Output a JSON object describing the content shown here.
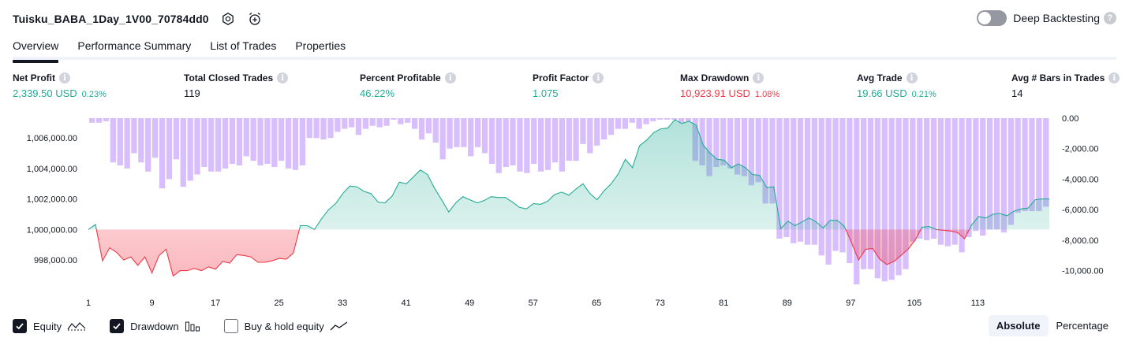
{
  "header": {
    "strategy_name": "Tuisku_BABA_1Day_1V00_70784dd0",
    "icons": [
      "settings-icon",
      "add-alert-icon"
    ]
  },
  "deep_backtesting": {
    "label": "Deep Backtesting",
    "enabled": false,
    "help_icon": "?"
  },
  "tabs": [
    {
      "label": "Overview",
      "active": true
    },
    {
      "label": "Performance Summary",
      "active": false
    },
    {
      "label": "List of Trades",
      "active": false
    },
    {
      "label": "Properties",
      "active": false
    }
  ],
  "metrics": {
    "net_profit": {
      "label": "Net Profit",
      "value": "2,339.50 USD",
      "pct": "0.23%"
    },
    "total_closed_trades": {
      "label": "Total Closed Trades",
      "value": "119"
    },
    "percent_profitable": {
      "label": "Percent Profitable",
      "value": "46.22%"
    },
    "profit_factor": {
      "label": "Profit Factor",
      "value": "1.075"
    },
    "max_drawdown": {
      "label": "Max Drawdown",
      "value": "10,923.91 USD",
      "pct": "1.08%"
    },
    "avg_trade": {
      "label": "Avg Trade",
      "value": "19.66 USD",
      "pct": "0.21%"
    },
    "avg_bars": {
      "label": "Avg # Bars in Trades",
      "value": "14"
    }
  },
  "colors": {
    "profit": "#22ab94",
    "loss": "#f23645",
    "drawdown_bar": "#d1b3fb",
    "equity_area_pos": "#22ab94",
    "equity_area_neg": "#f23645",
    "text": "#131722"
  },
  "chart_data": {
    "type": "line",
    "left_axis": {
      "ticks": [
        998000,
        1000000,
        1002000,
        1004000,
        1006000
      ],
      "tick_labels": [
        "998,000.00",
        "1,000,000.00",
        "1,002,000.00",
        "1,004,000.00",
        "1,006,000.00"
      ],
      "range": [
        996300,
        1007300
      ]
    },
    "right_axis": {
      "ticks": [
        0,
        -2000,
        -4000,
        -6000,
        -8000,
        -10000
      ],
      "tick_labels": [
        "0.00",
        "-2,000.00",
        "-4,000.00",
        "-6,000.00",
        "-8,000.00",
        "-10,000.00"
      ],
      "range": [
        -11000,
        0
      ]
    },
    "x_axis": {
      "ticks": [
        1,
        9,
        17,
        25,
        33,
        41,
        49,
        57,
        65,
        73,
        81,
        89,
        97,
        105,
        113
      ],
      "range": [
        1,
        122
      ]
    },
    "baseline": 1000000,
    "series": [
      {
        "name": "Equity",
        "values": [
          1000000,
          1000330,
          997950,
          998800,
          998500,
          998000,
          998200,
          997650,
          998200,
          997150,
          998300,
          998700,
          996950,
          997300,
          997300,
          997450,
          997300,
          997550,
          997400,
          997900,
          997800,
          998350,
          998300,
          998200,
          997850,
          997850,
          997950,
          998100,
          998050,
          998450,
          1000250,
          1000250,
          1000000,
          1000700,
          1001300,
          1001700,
          1002350,
          1002850,
          1002800,
          1002500,
          1002350,
          1001800,
          1001750,
          1002200,
          1003100,
          1003000,
          1003450,
          1003900,
          1003600,
          1002700,
          1001950,
          1001150,
          1001750,
          1002150,
          1001950,
          1001750,
          1001900,
          1002150,
          1002100,
          1002100,
          1001800,
          1001450,
          1001350,
          1001700,
          1001650,
          1001850,
          1002300,
          1002450,
          1002250,
          1002650,
          1003000,
          1002350,
          1001950,
          1002550,
          1003000,
          1003650,
          1004600,
          1004050,
          1005500,
          1005850,
          1006350,
          1006600,
          1006650,
          1007200,
          1006950,
          1007100,
          1006850,
          1005550,
          1005000,
          1004600,
          1004550,
          1004050,
          1004300,
          1004050,
          1003600,
          1003550,
          1002750,
          1002800,
          1000050,
          1000550,
          1000250,
          1000500,
          1000750,
          1000500,
          1000100,
          1000600,
          1000600,
          1000200,
          999150,
          998000,
          998700,
          998750,
          998050,
          997700,
          997900,
          998300,
          998700,
          999300,
          1000150,
          1000200,
          1000000,
          999950,
          999900,
          999800,
          999400,
          1000300,
          1000850,
          1000750,
          1001000,
          1001050,
          1000900,
          1001200,
          1001350,
          1001400,
          1001950,
          1002000,
          1002000
        ]
      },
      {
        "name": "Drawdown",
        "values": [
          -300,
          -300,
          -200,
          -2900,
          -3100,
          -3300,
          -2300,
          -2900,
          -3500,
          -2600,
          -4600,
          -4000,
          -2700,
          -4500,
          -4100,
          -3700,
          -3200,
          -3500,
          -3500,
          -3300,
          -3000,
          -3100,
          -2500,
          -2800,
          -3100,
          -3000,
          -3200,
          -2800,
          -3300,
          -3400,
          -3100,
          -1300,
          -1300,
          -1400,
          -1300,
          -900,
          -700,
          -600,
          -1100,
          -700,
          -500,
          -600,
          -500,
          -100,
          -400,
          -300,
          -700,
          -1400,
          -1000,
          -1600,
          -2700,
          -2000,
          -1900,
          -1900,
          -2500,
          -1900,
          -2300,
          -3000,
          -3600,
          -3200,
          -3100,
          -3500,
          -3600,
          -3000,
          -3500,
          -3400,
          -2900,
          -3500,
          -2800,
          -2800,
          -1700,
          -2300,
          -1800,
          -1400,
          -1100,
          -700,
          -700,
          -300,
          -700,
          -400,
          -200,
          -100,
          -100,
          -100,
          -300,
          -200,
          -2800,
          -3100,
          -3800,
          -3200,
          -3100,
          -3300,
          -3700,
          -3800,
          -4400,
          -4200,
          -5600,
          -5600,
          -7900,
          -7800,
          -8200,
          -8100,
          -8300,
          -8300,
          -9000,
          -9600,
          -8700,
          -8800,
          -9500,
          -10900,
          -9900,
          -9900,
          -10500,
          -10700,
          -10600,
          -10300,
          -9900,
          -8100,
          -7900,
          -8000,
          -7900,
          -8300,
          -8400,
          -8300,
          -8800,
          -7800,
          -7400,
          -7700,
          -7300,
          -7300,
          -7500,
          -7000,
          -6200,
          -6100,
          -6100,
          -6100,
          -5800
        ]
      },
      {
        "name": "Buy & hold equity",
        "values": []
      }
    ]
  },
  "legend": {
    "equity": {
      "label": "Equity",
      "checked": true,
      "icon": "equity-line-icon"
    },
    "drawdown": {
      "label": "Drawdown",
      "checked": true,
      "icon": "drawdown-bars-icon"
    },
    "buy_hold": {
      "label": "Buy & hold equity",
      "checked": false,
      "icon": "buy-hold-line-icon"
    }
  },
  "scale": {
    "absolute_label": "Absolute",
    "percentage_label": "Percentage",
    "selected": "Absolute"
  }
}
